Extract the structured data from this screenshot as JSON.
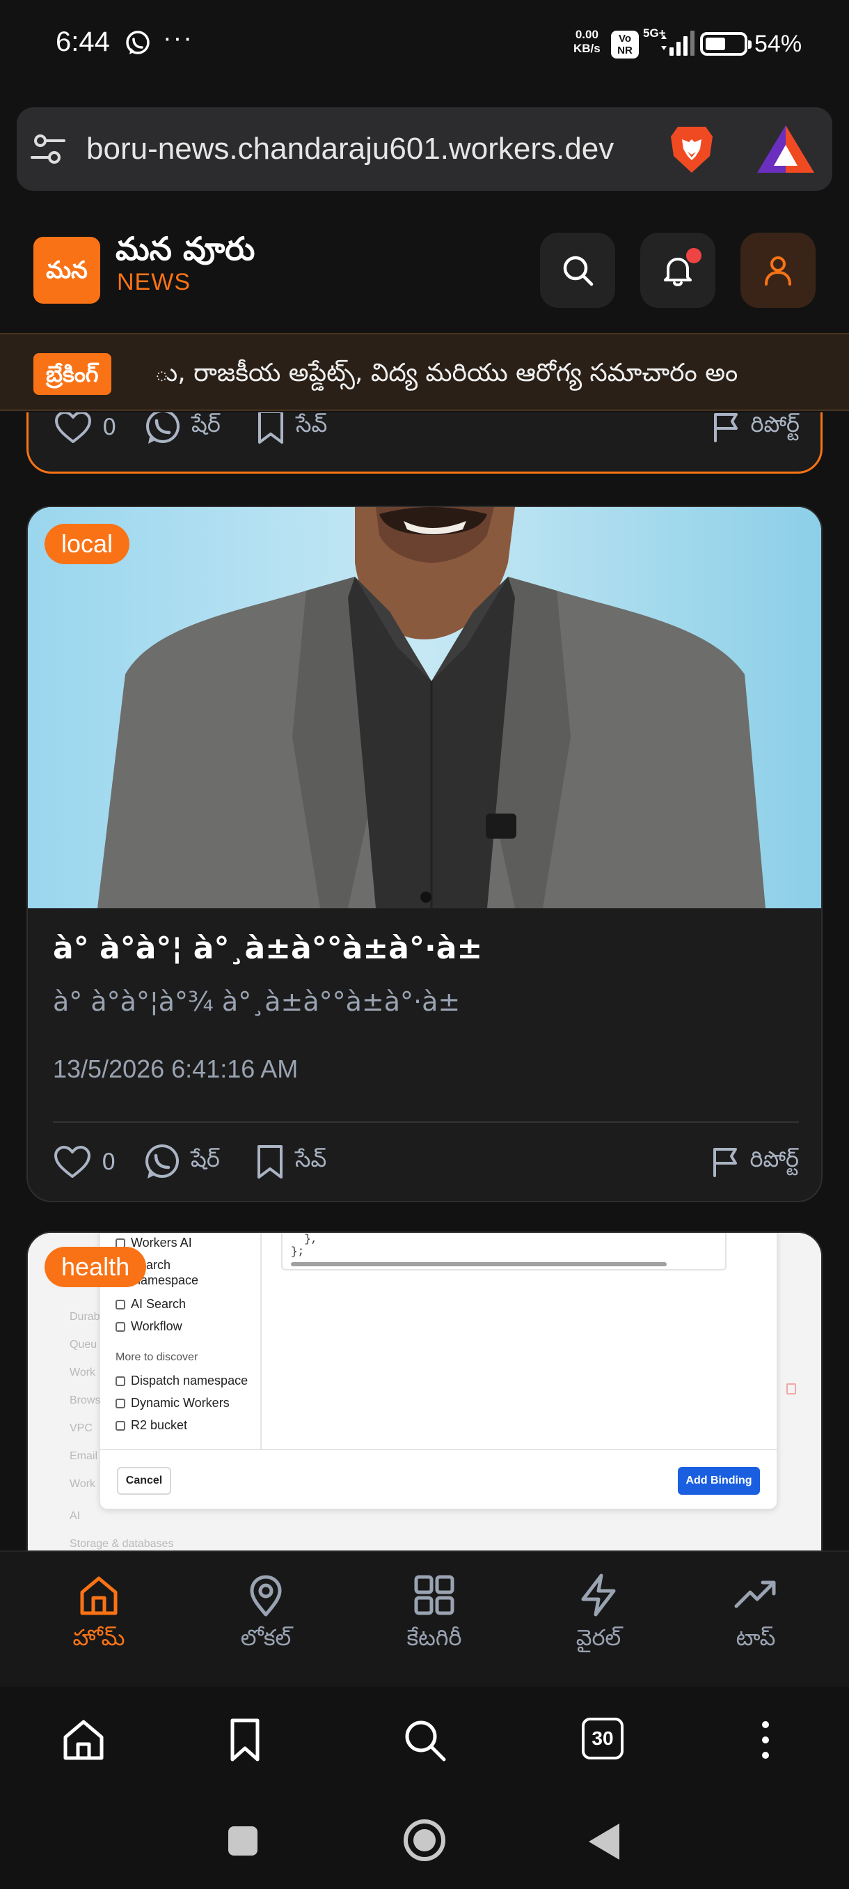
{
  "status_bar": {
    "time": "6:44",
    "more": "···",
    "speed_value": "0.00",
    "speed_unit": "KB/s",
    "volte": "Vo\nNR",
    "network": "5G+",
    "battery_percent": "54%",
    "battery_level": 0.54
  },
  "browser": {
    "url": "boru-news.chandaraju601.workers.dev",
    "tabs_count": "30"
  },
  "app": {
    "logo_text": "మన",
    "title": "మన వూరు",
    "subtitle": "NEWS",
    "accent_color": "#f97316"
  },
  "ticker": {
    "badge": "బ్రేకింగ్",
    "text": "ు, రాజకీయ అప్డేట్స్, విద్య మరియు ఆరోగ్య సమాచారం అం"
  },
  "previous_card": {
    "likes": "0",
    "share_label": "షేర్",
    "save_label": "సేవ్",
    "report_label": "రిపోర్ట్"
  },
  "main_card": {
    "category": "local",
    "title": "à°  à°à°¦ à°¸à±à°°à±à°·à±",
    "description": "à°  à°à°¦à°¾ à°¸à±à°°à±à°·à±",
    "date": "13/5/2026 6:41:16 AM",
    "likes": "0",
    "share_label": "షేర్",
    "save_label": "సేవ్",
    "report_label": "రిపోర్ట్"
  },
  "next_card": {
    "category": "health",
    "screenshot": {
      "sidebar_bg": [
        "Durab",
        "Queu",
        "Work",
        "Brows",
        "VPC",
        "Email",
        "Work",
        "AI",
        "Storage & databases"
      ],
      "items_top": [
        "Workers AI",
        "Search",
        "namespace",
        "AI Search",
        "Workflow"
      ],
      "section": "More to discover",
      "items_more": [
        "Dispatch namespace",
        "Dynamic Workers",
        "R2 bucket"
      ],
      "code": "  },\n};",
      "cancel": "Cancel",
      "add_binding": "Add Binding"
    }
  },
  "bottom_nav": [
    {
      "label": "హోమ్",
      "icon": "home-icon",
      "active": true
    },
    {
      "label": "లోకల్",
      "icon": "map-pin-icon",
      "active": false
    },
    {
      "label": "కేటగిరీ",
      "icon": "grid-icon",
      "active": false
    },
    {
      "label": "వైరల్",
      "icon": "zap-icon",
      "active": false
    },
    {
      "label": "టాప్",
      "icon": "trending-up-icon",
      "active": false
    }
  ]
}
